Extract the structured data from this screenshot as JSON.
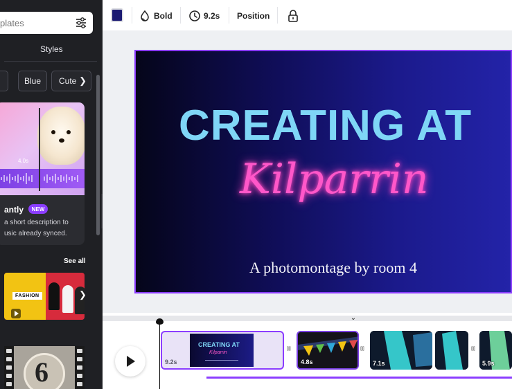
{
  "sidebar": {
    "search_placeholder": "plates",
    "tab_label": "Styles",
    "chips": [
      "Blue",
      "Cute"
    ],
    "promo": {
      "duration": "4.0s",
      "title": "antly",
      "badge": "NEW",
      "description": "a short description to usic already synced."
    },
    "see_all": "See all",
    "fashion_label": "FASHION",
    "countdown_number": "6"
  },
  "toolbar": {
    "swatch_color": "#1b1a72",
    "font_style": "Bold",
    "duration": "9.2s",
    "position_label": "Position"
  },
  "slide": {
    "title": "CREATING AT",
    "script": "Kilparrin",
    "subtitle": "A photomontage by room 4"
  },
  "timeline": {
    "clips": [
      {
        "duration": "9.2s",
        "title": "CREATING AT",
        "script": "Kilparrin"
      },
      {
        "duration": "4.8s"
      },
      {
        "duration": "7.1s"
      },
      {
        "duration": ""
      },
      {
        "duration": "5.9s"
      }
    ]
  },
  "colors": {
    "accent": "#8b3dff",
    "title_cyan": "#7fd6f6",
    "neon_pink": "#ff57c9"
  }
}
